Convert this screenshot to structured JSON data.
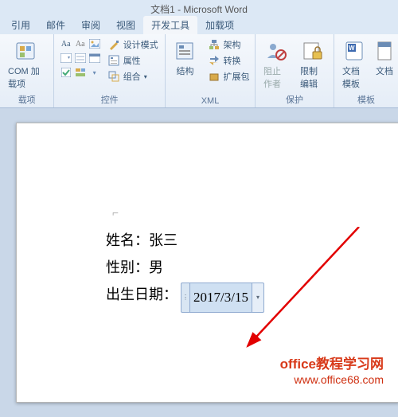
{
  "window": {
    "title": "文档1 - Microsoft Word"
  },
  "tabs": {
    "items": [
      "引用",
      "邮件",
      "审阅",
      "视图",
      "开发工具",
      "加载项"
    ],
    "active_index": 4
  },
  "ribbon": {
    "addins": {
      "btn": "COM 加载项",
      "group": "载项"
    },
    "controls": {
      "design": "设计模式",
      "properties": "属性",
      "group_btn": "组合",
      "group": "控件"
    },
    "xml": {
      "structure": "结构",
      "schema": "架构",
      "transform": "转换",
      "expand": "扩展包",
      "group": "XML"
    },
    "protect": {
      "block": "阻止作者",
      "restrict": "限制编辑",
      "group": "保护"
    },
    "template": {
      "tpl": "文档模板",
      "panel": "文档",
      "group": "模板"
    }
  },
  "document": {
    "name_label": "姓名：",
    "name_value": "张三",
    "gender_label": "性别：",
    "gender_value": "男",
    "dob_label": "出生日期：",
    "dob_value": "2017/3/15"
  },
  "watermark": {
    "line1": "office教程学习网",
    "line2": "www.office68.com"
  }
}
